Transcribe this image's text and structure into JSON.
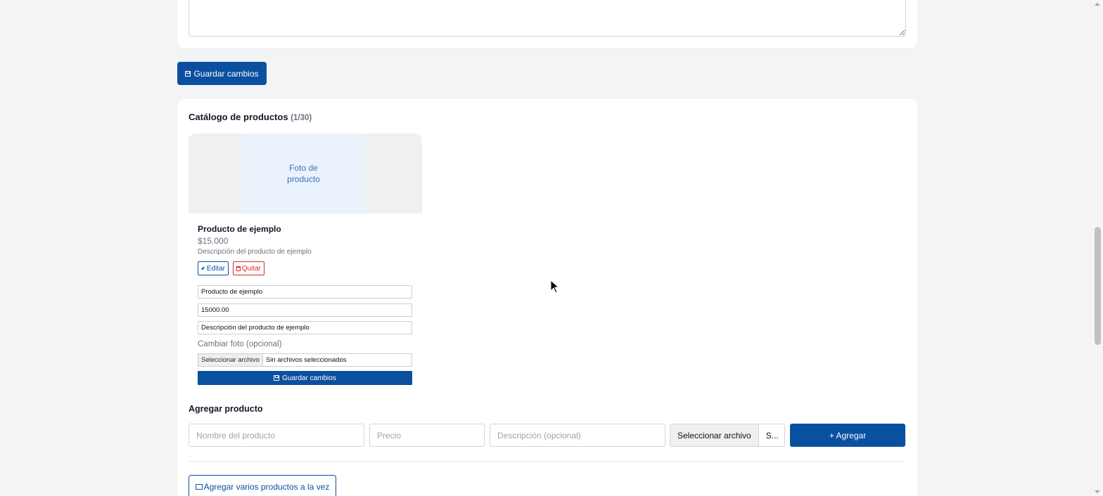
{
  "top_card": {
    "textarea_value": ""
  },
  "save_main_label": "Guardar cambios",
  "catalog": {
    "title": "Catálogo de productos",
    "count": "(1/30)",
    "product": {
      "photo_placeholder": "Foto de producto",
      "name": "Producto de ejemplo",
      "price": "$15.000",
      "description": "Descripción del producto de ejemplo",
      "edit_label": "Editar",
      "remove_label": "Quitar",
      "edit_name_value": "Producto de ejemplo",
      "edit_price_value": "15000.00",
      "edit_desc_value": "Descripción del producto de ejemplo",
      "change_photo_label": "Cambiar foto (opcional)",
      "file_choose_label": "Seleccionar archivo",
      "file_status": "Sin archivos seleccionados",
      "save_label": "Guardar cambios"
    }
  },
  "add_product": {
    "title": "Agregar producto",
    "name_placeholder": "Nombre del producto",
    "price_placeholder": "Precio",
    "desc_placeholder": "Descripción (opcional)",
    "file_choose_label": "Seleccionar archivo",
    "file_status": "S...",
    "add_label": "+ Agregar",
    "bulk_label": "Agregar varios productos a la vez"
  },
  "colors": {
    "primary": "#0b4fa0",
    "danger": "#dc2626",
    "background": "#f3f4f6"
  }
}
